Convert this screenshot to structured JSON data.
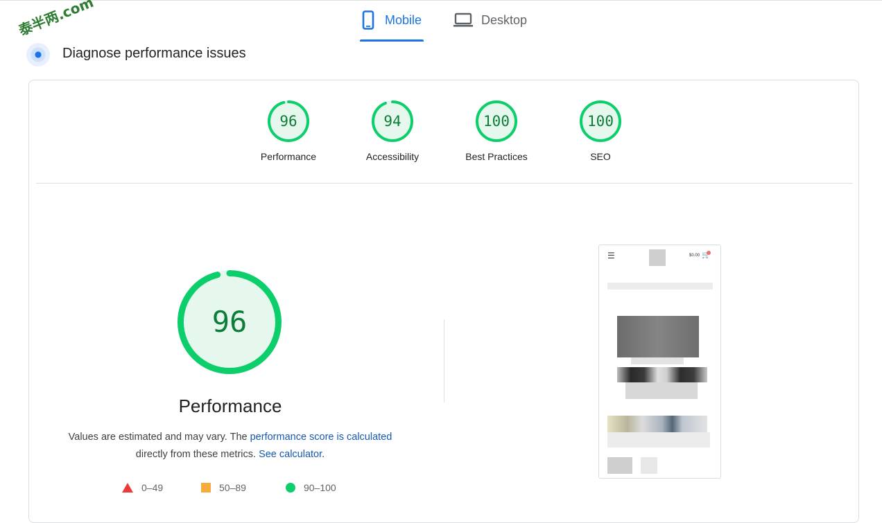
{
  "tabs": {
    "mobile_label": "Mobile",
    "desktop_label": "Desktop",
    "active": "Mobile"
  },
  "watermark": "泰半两.com",
  "section": {
    "title": "Diagnose performance issues"
  },
  "scores": [
    {
      "label": "Performance",
      "value": "96",
      "fraction": 0.96
    },
    {
      "label": "Accessibility",
      "value": "94",
      "fraction": 0.94
    },
    {
      "label": "Best Practices",
      "value": "100",
      "fraction": 1.0
    },
    {
      "label": "SEO",
      "value": "100",
      "fraction": 1.0
    }
  ],
  "main": {
    "score": "96",
    "score_fraction": 0.96,
    "title": "Performance",
    "desc_text1": "Values are estimated and may vary. The ",
    "desc_link1": "performance score is calculated",
    "desc_text2": "directly from these metrics. ",
    "desc_link2": "See calculator",
    "desc_end": "."
  },
  "legend": [
    {
      "label": "0–49",
      "color": "#eb3a3a",
      "shape": "triangle"
    },
    {
      "label": "50–89",
      "color": "#f7ab3b",
      "shape": "square"
    },
    {
      "label": "90–100",
      "color": "#0cce6b",
      "shape": "circle"
    }
  ],
  "screenshot": {
    "menu_icon": "hamburger-icon",
    "price": "$0.00",
    "cart_icon": "cart-icon"
  },
  "colors": {
    "accent": "#1a73e8",
    "pass_ring": "#0cce6b",
    "pass_text": "#0c7d36",
    "pass_fill": "#e6f8ee"
  }
}
